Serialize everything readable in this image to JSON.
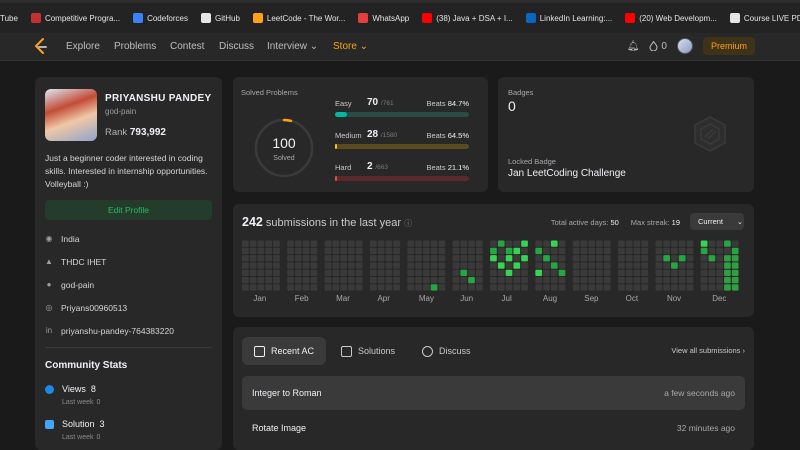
{
  "bookmarks": [
    {
      "label": "Tube",
      "color": "#cc0000"
    },
    {
      "label": "Competitive Progra...",
      "color": "#c53030"
    },
    {
      "label": "Codeforces",
      "color": "#3b82f6"
    },
    {
      "label": "GitHub",
      "color": "#e5e5e5"
    },
    {
      "label": "LeetCode - The Wor...",
      "color": "#ffa116"
    },
    {
      "label": "WhatsApp",
      "color": "#e53e3e"
    },
    {
      "label": "(38) Java + DSA + I...",
      "color": "#ff0000"
    },
    {
      "label": "LinkedIn Learning:...",
      "color": "#0a66c2"
    },
    {
      "label": "(20) Web Developm...",
      "color": "#ff0000"
    },
    {
      "label": "Course LIVE PDFs",
      "color": "#e5e5e5"
    }
  ],
  "nav": {
    "items": [
      "Explore",
      "Problems",
      "Contest",
      "Discuss",
      "Interview ⌄",
      "Store ⌄"
    ],
    "fire_count": "0",
    "premium_label": "Premium"
  },
  "profile": {
    "name": "PRIYANSHU PANDEY",
    "username": "god-pain",
    "rank_label": "Rank",
    "rank_value": "793,992",
    "bio": "Just a beginner coder interested in coding skills. Interested in internship opportunities. Volleyball :)",
    "edit_label": "Edit Profile",
    "info": [
      {
        "icon": "location-icon",
        "glyph": "◉",
        "text": "India"
      },
      {
        "icon": "school-icon",
        "glyph": "▲",
        "text": "THDC IHET"
      },
      {
        "icon": "github-icon",
        "glyph": "●",
        "text": "god-pain"
      },
      {
        "icon": "twitter-icon",
        "glyph": "◎",
        "text": "Priyans00960513"
      },
      {
        "icon": "linkedin-icon",
        "glyph": "in",
        "text": "priyanshu-pandey-764383220"
      }
    ],
    "community_title": "Community Stats",
    "stats": [
      {
        "label": "Views",
        "value": "8",
        "sub": "Last week",
        "sub_value": "0",
        "color": "#1e88e5"
      },
      {
        "label": "Solution",
        "value": "3",
        "sub": "Last week",
        "sub_value": "0",
        "color": "#42a5f5"
      }
    ]
  },
  "solved": {
    "title": "Solved Problems",
    "total": "100",
    "total_label": "Solved",
    "total_fraction": 0.04,
    "rows": [
      {
        "name": "Easy",
        "count": "70",
        "total": "/761",
        "beats_label": "Beats",
        "beats": "84.7%",
        "fraction": 0.092,
        "color": "#00b8a3",
        "track": "#2a4a45"
      },
      {
        "name": "Medium",
        "count": "28",
        "total": "/1580",
        "beats_label": "Beats",
        "beats": "64.5%",
        "fraction": 0.018,
        "color": "#ffc01e",
        "track": "#5a4a1e"
      },
      {
        "name": "Hard",
        "count": "2",
        "total": "/663",
        "beats_label": "Beats",
        "beats": "21.1%",
        "fraction": 0.003,
        "color": "#ef4743",
        "track": "#5a2a2a"
      }
    ]
  },
  "badges": {
    "title": "Badges",
    "count": "0",
    "locked_label": "Locked Badge",
    "locked_name": "Jan LeetCoding Challenge"
  },
  "submissions": {
    "count": "242",
    "label": "submissions in the last year",
    "active_label": "Total active days:",
    "active_value": "50",
    "streak_label": "Max streak:",
    "streak_value": "19",
    "current_label": "Current",
    "months": [
      "Jan",
      "Feb",
      "Mar",
      "Apr",
      "May",
      "Jun",
      "Jul",
      "Aug",
      "Sep",
      "Oct",
      "Nov",
      "Dec"
    ]
  },
  "recent": {
    "tabs": [
      {
        "label": "Recent AC",
        "icon": "recent-ac-icon"
      },
      {
        "label": "Solutions",
        "icon": "solutions-icon"
      },
      {
        "label": "Discuss",
        "icon": "discuss-icon"
      }
    ],
    "view_all": "View all submissions ›",
    "items": [
      {
        "title": "Integer to Roman",
        "time": "a few seconds ago"
      },
      {
        "title": "Rotate Image",
        "time": "32 minutes ago"
      }
    ]
  }
}
